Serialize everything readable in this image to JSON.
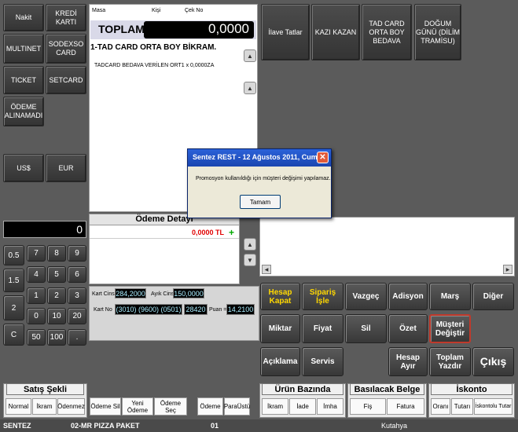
{
  "payment_buttons": {
    "nakit": "Nakit",
    "kredi_karti": "KREDİ KARTI",
    "multinet": "MULTINET",
    "sodexo_card": "SODEXSO CARD",
    "ticket": "TICKET",
    "setcard": "SETCARD",
    "odeme_alinamadi": "ÖDEME ALINAMADI",
    "usd": "US$",
    "eur": "EUR"
  },
  "keypad": {
    "display": "0",
    "multipliers": [
      "0.5",
      "1.5",
      "2",
      "C"
    ],
    "keys": [
      "7",
      "8",
      "9",
      "4",
      "5",
      "6",
      "1",
      "2",
      "3",
      "0",
      "10",
      "20",
      "50",
      "100",
      "."
    ]
  },
  "order": {
    "hdr_masa": "Masa",
    "hdr_kisi": "Kişi",
    "hdr_cek_no": "Çek No",
    "toplam_label": "TOPLAM",
    "toplam_value": "0,0000",
    "item_title": "1-TAD CARD ORTA BOY BİKRAM.",
    "item_line": "TADCARD BEDAVA VERİLEN ORT1  x  0,0000ZA"
  },
  "payment_detail": {
    "title": "Ödeme Detayı",
    "amount": "0,0000 TL",
    "plus": "+"
  },
  "card_info": {
    "kart_cins_label": "Kart Cins",
    "kart_cins_value": "284,2000",
    "ayik_cins_label": "Ayık Cins",
    "ayik_cins_value": "150,0000",
    "kart_no_label": "Kart No",
    "kart_no_value": "(3010) (9600) (0501)",
    "kart_extra_value": "28420",
    "puan_label": "Puan =",
    "puan_value": "14,2100"
  },
  "extras": {
    "ilave_tatlar": "İlave Tatlar",
    "kazi_kazan": "KAZI KAZAN",
    "tad_card": "TAD CARD ORTA BOY BEDAVA",
    "dogum_gunu": "DOĞUM GÜNÜ (DİLİM TRAMİSU)"
  },
  "actions": {
    "hesap_kapat": "Hesap Kapat",
    "siparis_isle": "Sipariş İşle",
    "vazgec": "Vazgeç",
    "adisyon": "Adisyon",
    "mars": "Marş",
    "diger": "Diğer",
    "miktar": "Miktar",
    "fiyat": "Fiyat",
    "sil": "Sil",
    "ozet": "Özet",
    "musteri_degistir": "Müşteri Değiştir",
    "aciklama": "Açıklama",
    "servis": "Servis",
    "hesap_ayir": "Hesap Ayır",
    "toplam_yazdir": "Toplam Yazdır",
    "cikis": "Çıkış"
  },
  "satis_sekli": {
    "title": "Satış Şekli",
    "options": [
      "Normal",
      "İkram",
      "Ödenmez"
    ]
  },
  "odeme_buttons": [
    "Ödeme Sil",
    "Yeni Ödeme",
    "Ödeme Seç"
  ],
  "odeme_para": [
    "Ödeme",
    "ParaÜstü"
  ],
  "urun_bazinda": {
    "title": "Ürün Bazında",
    "options": [
      "İkram",
      "İade",
      "İmha"
    ]
  },
  "basilacak_belge": {
    "title": "Basılacak Belge",
    "options": [
      "Fiş",
      "Fatura"
    ]
  },
  "iskonto": {
    "title": "İskonto",
    "options": [
      "Oranı",
      "Tutarı",
      "İskontolu Tutar"
    ]
  },
  "status": {
    "company": "SENTEZ",
    "table": "02-MR PIZZA PAKET",
    "number": "01",
    "city": "Kutahya"
  },
  "dialog": {
    "title": "Sentez REST  -  12 Ağustos 2011, Cuma.",
    "message": "Promosyon kullanıldığı için müşteri değişimi yapılamaz.",
    "ok": "Tamam"
  },
  "colors": {
    "background": "#5b5b5b",
    "accent_yellow": "#ffd800",
    "dialog_blue": "#1f4fc8",
    "highlight_red": "#c0392b"
  }
}
